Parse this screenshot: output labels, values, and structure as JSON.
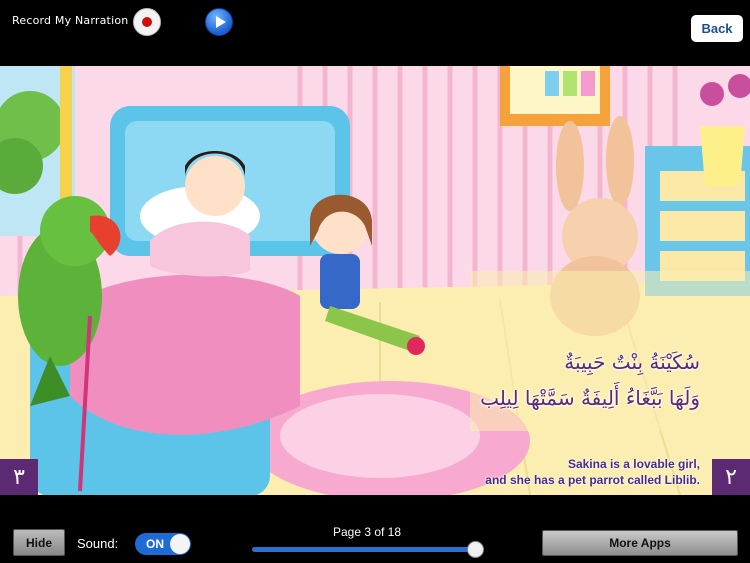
{
  "toolbar": {
    "record_label": "Record My Narration",
    "back_label": "Back"
  },
  "page": {
    "left_page_number": "٣",
    "right_page_number": "٢",
    "arabic_lines": [
      "سُكَيْنَةُ بِنْتٌ حَبِيبَةٌ",
      "وَلَهَا بَبَّغَاءُ أَلِيفَةٌ سَمَّتْهَا لِيلِب"
    ],
    "english_lines": [
      "Sakina is a lovable girl,",
      "and she has a pet parrot called Liblib."
    ]
  },
  "bottom": {
    "hide_label": "Hide",
    "sound_label": "Sound:",
    "sound_toggle": "ON",
    "page_indicator": "Page 3 of 18",
    "more_apps_label": "More Apps",
    "progress": 0.95
  },
  "colors": {
    "accent_purple": "#5b2a73",
    "toggle_blue": "#1f6bd6",
    "record_red": "#d10d0d"
  },
  "icons": [
    "record-icon",
    "play-icon"
  ]
}
